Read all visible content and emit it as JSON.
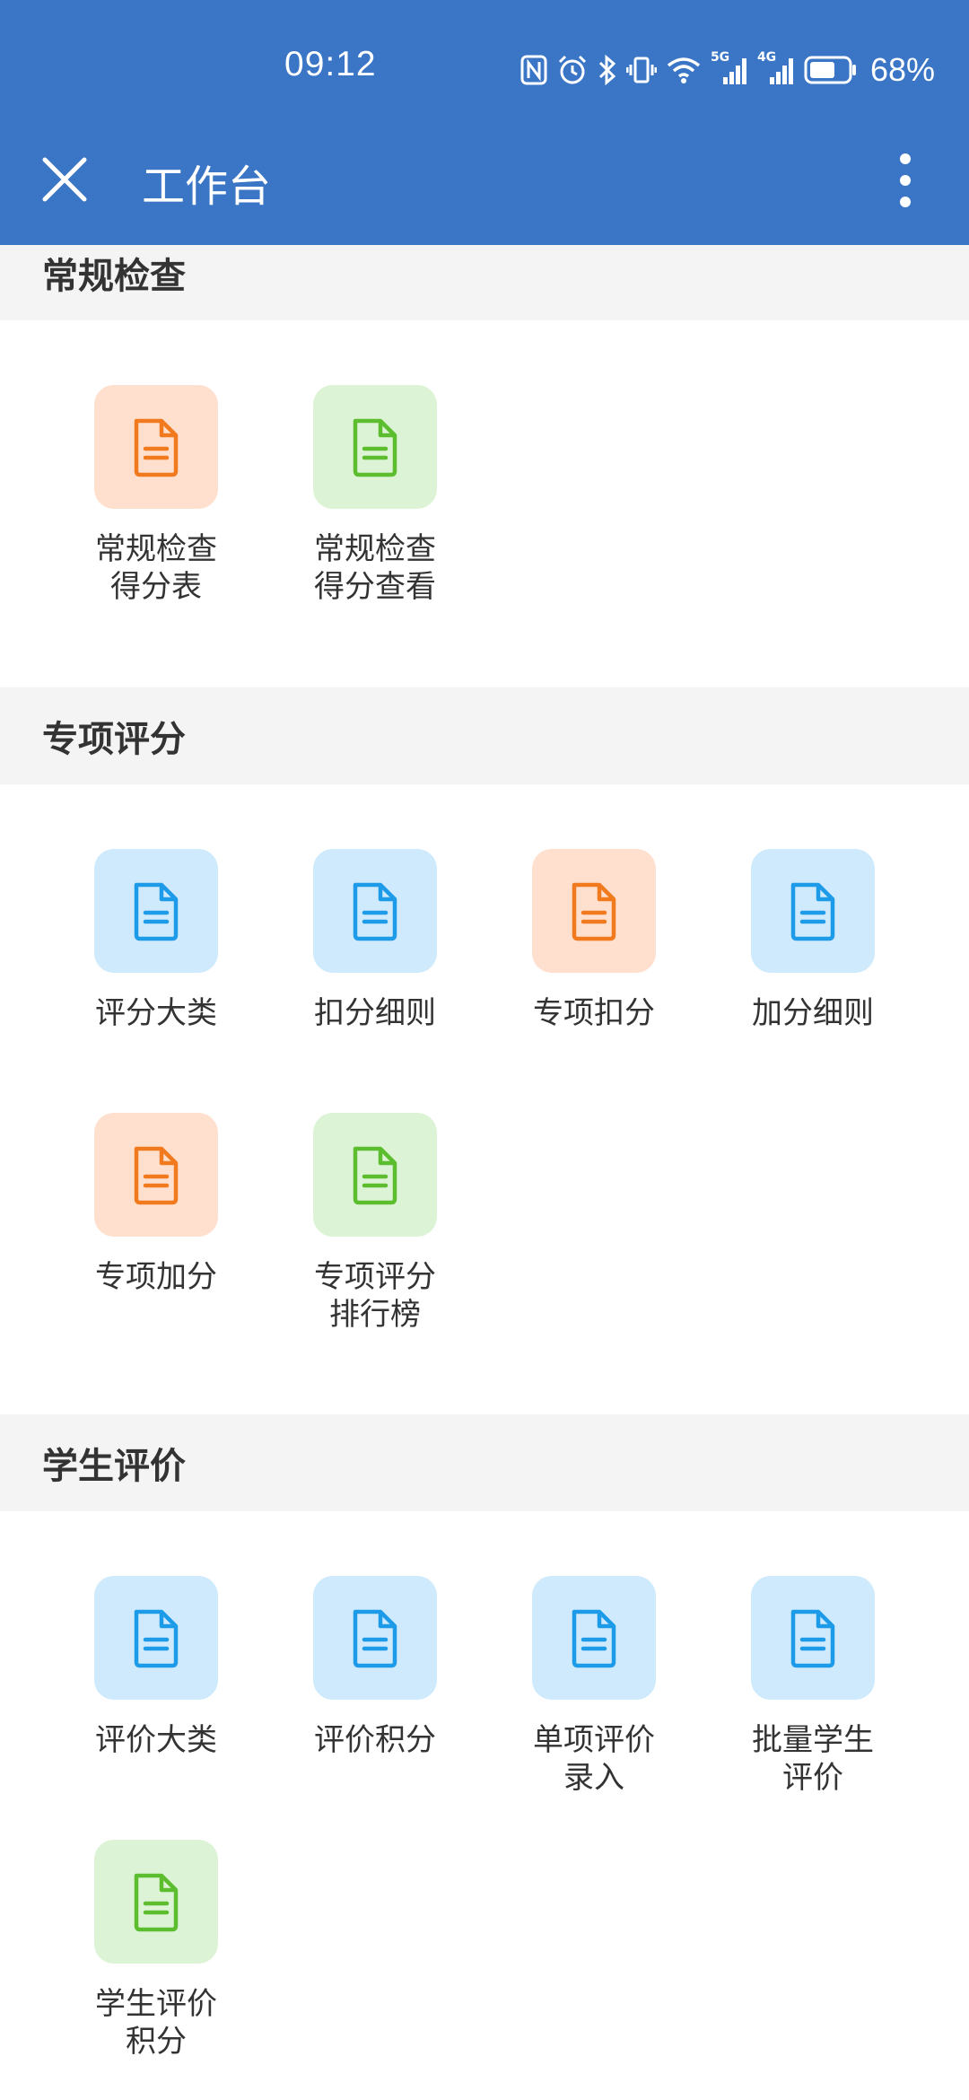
{
  "status_bar": {
    "time": "09:12",
    "battery_percent": "68%",
    "battery_level": 0.68,
    "icons": [
      "nfc-icon",
      "alarm-icon",
      "bluetooth-icon",
      "vibrate-icon",
      "wifi-icon",
      "signal-5g-icon",
      "signal-4g-icon",
      "battery-icon"
    ],
    "network_5g": "5G",
    "network_4g": "4G"
  },
  "header": {
    "title": "工作台",
    "close_icon": "close-icon",
    "more_icon": "more-vertical-icon"
  },
  "colors": {
    "header_bg": "#3A75C6",
    "orange": "#F27A1E",
    "green": "#5CBE2E",
    "blue": "#1E9BE8"
  },
  "sections": [
    {
      "title": "常规检查",
      "items": [
        {
          "label": "常规检查\n得分表",
          "color": "orange"
        },
        {
          "label": "常规检查\n得分查看",
          "color": "green"
        }
      ]
    },
    {
      "title": "专项评分",
      "items": [
        {
          "label": "评分大类",
          "color": "blue"
        },
        {
          "label": "扣分细则",
          "color": "blue"
        },
        {
          "label": "专项扣分",
          "color": "orange"
        },
        {
          "label": "加分细则",
          "color": "blue"
        },
        {
          "label": "专项加分",
          "color": "orange"
        },
        {
          "label": "专项评分\n排行榜",
          "color": "green"
        }
      ]
    },
    {
      "title": "学生评价",
      "items": [
        {
          "label": "评价大类",
          "color": "blue"
        },
        {
          "label": "评价积分",
          "color": "blue"
        },
        {
          "label": "单项评价\n录入",
          "color": "blue"
        },
        {
          "label": "批量学生\n评价",
          "color": "blue"
        },
        {
          "label": "学生评价\n积分",
          "color": "green"
        }
      ]
    }
  ]
}
